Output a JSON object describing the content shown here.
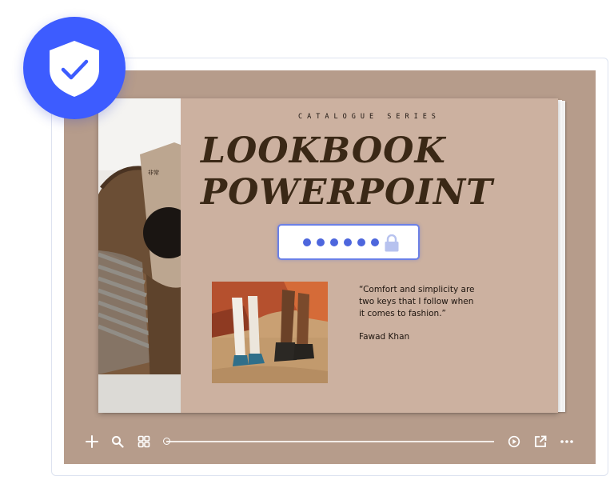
{
  "viewer": {
    "frame_color": "#b69c8b",
    "accent_color": "#3d5cff"
  },
  "slide": {
    "series_label": "CATALOGUE SERIES",
    "title_line1": "LOOKBOOK",
    "title_line2": "POWERPOINT",
    "quote": "“Comfort and simplicity are two keys that I follow when it comes to fashion.”",
    "author": "Fawad Khan",
    "background_color": "#ccb1a0",
    "title_color": "#3a2816"
  },
  "password_overlay": {
    "masked_dot_count": 6,
    "icon": "lock-icon",
    "dot_color": "#4d66dd"
  },
  "badge": {
    "icon": "shield-check-icon",
    "color": "#3d5cff"
  },
  "toolbar": {
    "icons": [
      "plus-icon",
      "search-icon",
      "grid-icon",
      "play-icon",
      "share-icon",
      "more-icon"
    ],
    "progress": 0
  }
}
